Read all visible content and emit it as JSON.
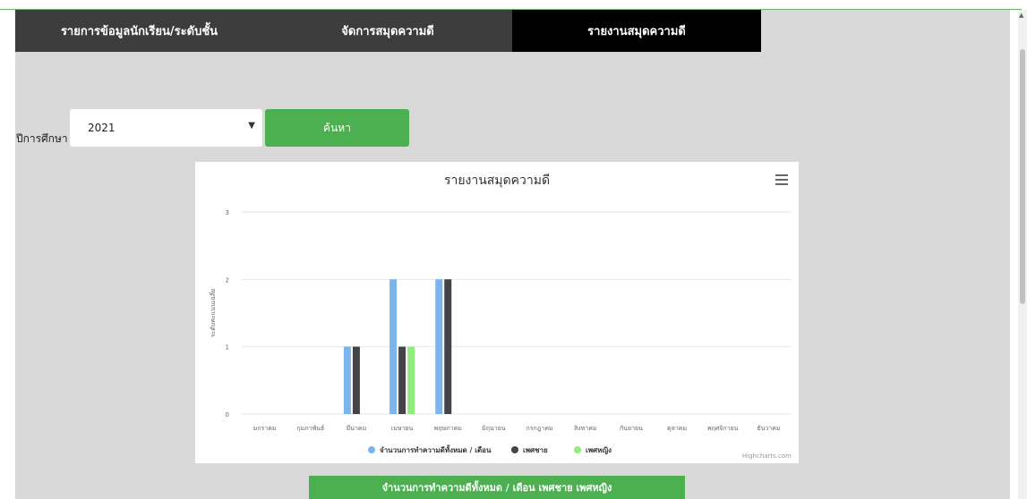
{
  "tabs": [
    {
      "label": "รายการข้อมูลนักเรียน/ระดับชั้น"
    },
    {
      "label": "จัดการสมุดความดี"
    },
    {
      "label": "รายงานสมุดความดี",
      "active": true
    }
  ],
  "filter": {
    "year_label": "ปีการศึกษา :",
    "year_value": "2021",
    "search_label": "ค้นหา"
  },
  "chart_data": {
    "type": "bar",
    "title": "รายงานสมุดความดี",
    "ylabel": "ระดับคะแนนเฉลี่ย",
    "ylim": [
      0,
      3
    ],
    "yticks": [
      "0",
      "1",
      "2",
      "3"
    ],
    "categories": [
      "มกราคม",
      "กุมภาพันธ์",
      "มีนาคม",
      "เมษายน",
      "พฤษภาคม",
      "มิถุนายน",
      "กรกฎาคม",
      "สิงหาคม",
      "กันยายน",
      "ตุลาคม",
      "พฤศจิกายน",
      "ธันวาคม"
    ],
    "series": [
      {
        "name": "จำนวนการทำความดีทั้งหมด / เดือน",
        "color": "#7cb5ec",
        "values": [
          0,
          0,
          1,
          2,
          2,
          0,
          0,
          0,
          0,
          0,
          0,
          0
        ]
      },
      {
        "name": "เพศชาย",
        "color": "#434348",
        "values": [
          0,
          0,
          1,
          1,
          2,
          0,
          0,
          0,
          0,
          0,
          0,
          0
        ]
      },
      {
        "name": "เพศหญิง",
        "color": "#90ed7d",
        "values": [
          0,
          0,
          0,
          1,
          0,
          0,
          0,
          0,
          0,
          0,
          0,
          0
        ]
      }
    ],
    "grid": true,
    "legend": "bottom-center",
    "credits": "Highcharts.com"
  },
  "bottom_button": {
    "label": "จำนวนการทำความดีทั้งหมด / เดือน     เพศชาย     เพศหญิง"
  }
}
